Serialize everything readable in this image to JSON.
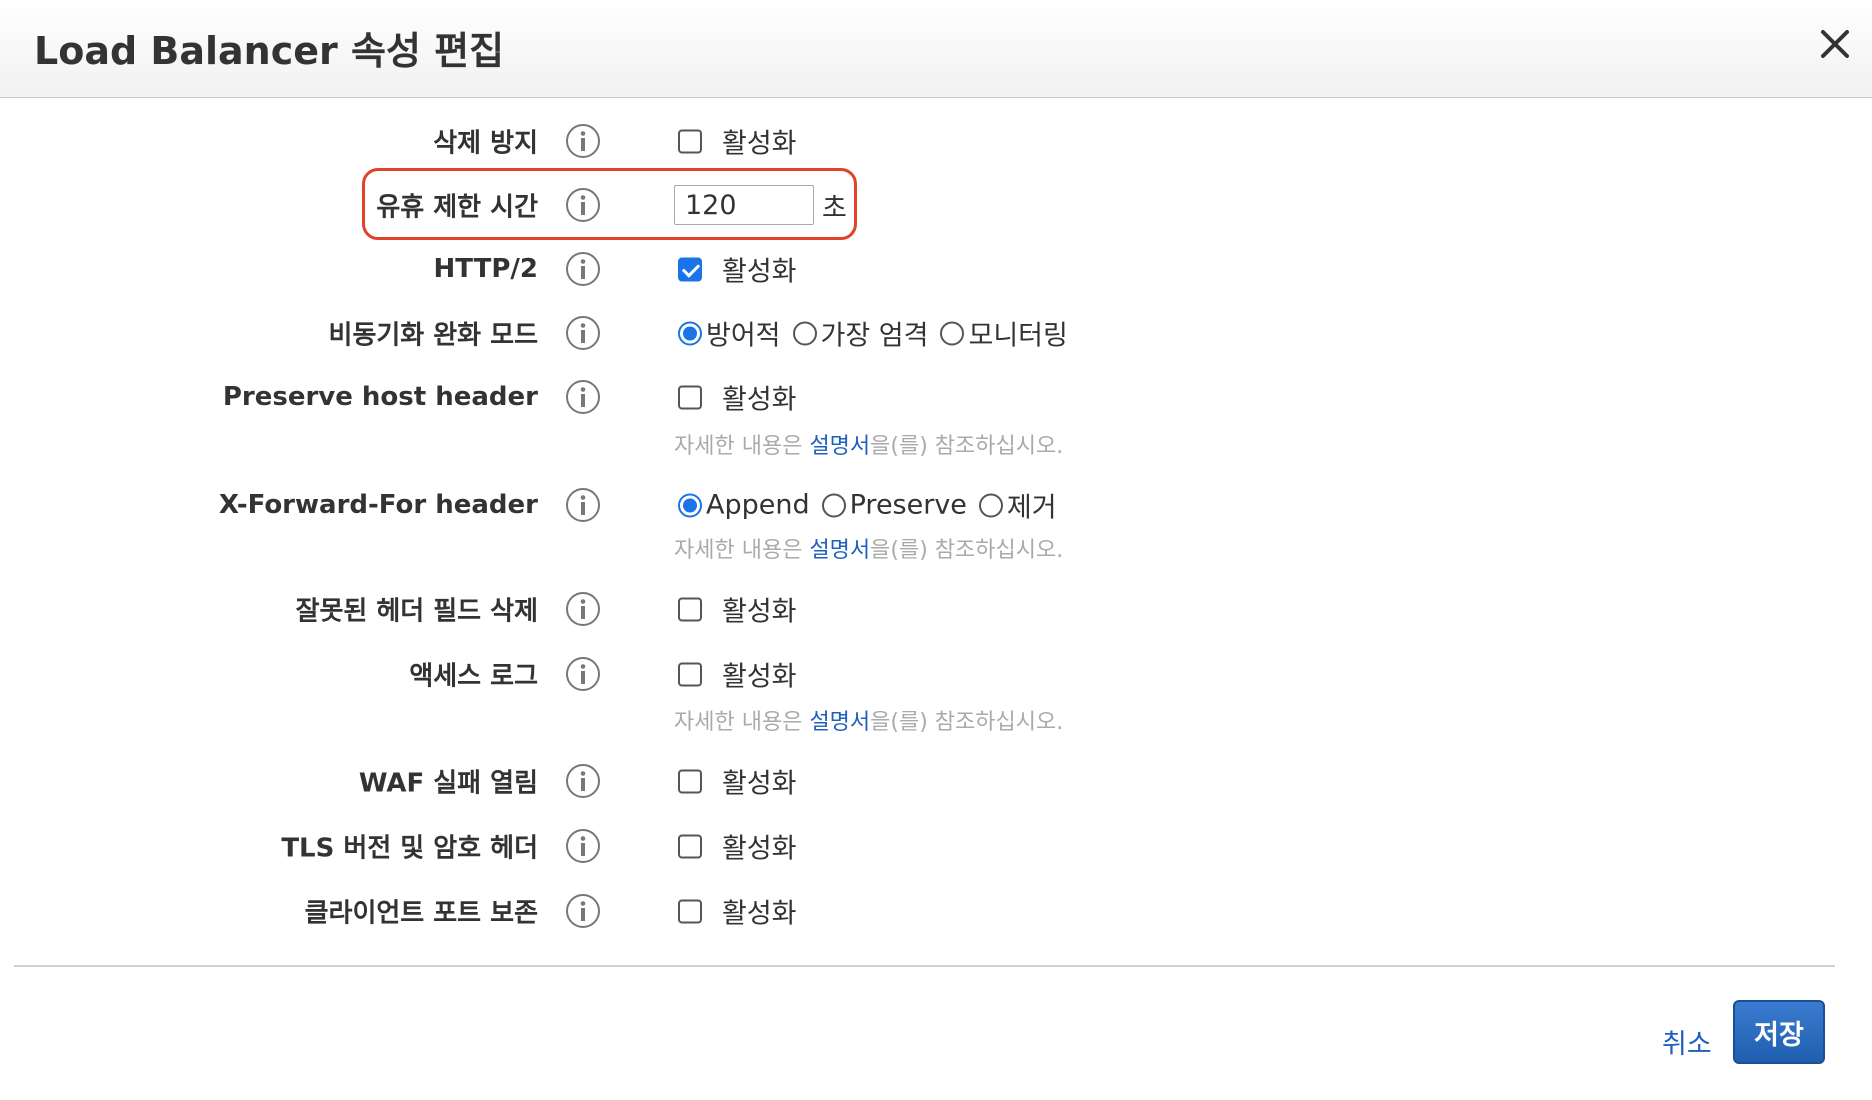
{
  "dialog": {
    "title": "Load Balancer 속성 편집"
  },
  "rows": {
    "deletion_protection": {
      "label": "삭제 방지",
      "option": "활성화",
      "checked": false
    },
    "idle_timeout": {
      "label": "유휴 제한 시간",
      "value": "120",
      "unit": "초"
    },
    "http2": {
      "label": "HTTP/2",
      "option": "활성화",
      "checked": true
    },
    "desync_mitigation": {
      "label": "비동기화 완화 모드",
      "options": [
        "방어적",
        "가장 엄격",
        "모니터링"
      ],
      "selected": "방어적"
    },
    "preserve_host_header": {
      "label": "Preserve host header",
      "option": "활성화",
      "checked": false
    },
    "xff_header": {
      "label": "X-Forward-For header",
      "options": [
        "Append",
        "Preserve",
        "제거"
      ],
      "selected": "Append"
    },
    "drop_invalid_headers": {
      "label": "잘못된 헤더 필드 삭제",
      "option": "활성화",
      "checked": false
    },
    "access_logs": {
      "label": "액세스 로그",
      "option": "활성화",
      "checked": false
    },
    "waf_fail_open": {
      "label": "WAF 실패 열림",
      "option": "활성화",
      "checked": false
    },
    "tls_headers": {
      "label": "TLS 버전 및 암호 헤더",
      "option": "활성화",
      "checked": false
    },
    "client_port": {
      "label": "클라이언트 포트 보존",
      "option": "활성화",
      "checked": false
    }
  },
  "hint": {
    "prefix": "자세한 내용은",
    "link": "설명서",
    "suffix": "을(를) 참조하십시오."
  },
  "footer": {
    "cancel_label": "취소",
    "save_label": "저장"
  },
  "colors": {
    "accent": "#1a73e8",
    "highlight_border": "#e0432a",
    "link": "#1f5fbf"
  },
  "icons": [
    "close-icon",
    "info-icon"
  ]
}
